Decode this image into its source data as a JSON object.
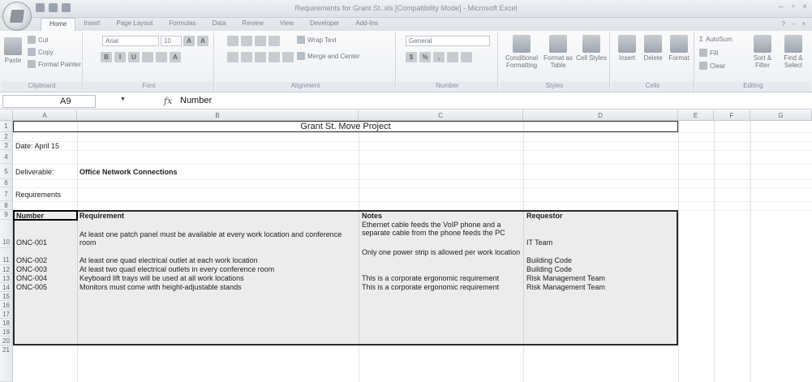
{
  "window": {
    "title": "Requirements for Grant St..xls [Compatibility Mode] - Microsoft Excel",
    "controls": [
      "–",
      "▫",
      "×"
    ]
  },
  "tabs": [
    "Home",
    "Insert",
    "Page Layout",
    "Formulas",
    "Data",
    "Review",
    "View",
    "Developer",
    "Add-Ins"
  ],
  "ribbon": {
    "clipboard": {
      "paste": "Paste",
      "cut": "Cut",
      "copy": "Copy",
      "format_painter": "Format Painter",
      "label": "Clipboard"
    },
    "font": {
      "name": "Arial",
      "size": "10",
      "label": "Font"
    },
    "alignment": {
      "wrap": "Wrap Text",
      "merge": "Merge and Center",
      "label": "Alignment"
    },
    "number": {
      "format": "General",
      "label": "Number"
    },
    "styles": {
      "conditional": "Conditional Formatting",
      "format_table": "Format as Table",
      "cell_styles": "Cell Styles",
      "label": "Styles"
    },
    "cells": {
      "insert": "Insert",
      "delete": "Delete",
      "format": "Format",
      "label": "Cells"
    },
    "editing": {
      "autosum": "AutoSum",
      "fill": "Fill",
      "clear": "Clear",
      "sort": "Sort & Filter",
      "find": "Find & Select",
      "label": "Editing"
    }
  },
  "formula_bar": {
    "name_box": "A9",
    "fx": "fx",
    "content": "Number"
  },
  "columns": [
    "A",
    "B",
    "C",
    "D",
    "E",
    "F",
    "G"
  ],
  "rows": [
    "1",
    "2",
    "3",
    "4",
    "5",
    "6",
    "7",
    "8",
    "9",
    "10",
    "11",
    "12",
    "13",
    "14",
    "15",
    "16",
    "17",
    "18",
    "19",
    "20",
    "21"
  ],
  "sheet": {
    "title": "Grant St. Move Project",
    "date": "Date: April 15",
    "deliverable_label": "Deliverable:",
    "deliverable_value": "Office Network Connections",
    "requirements_label": "Requirements",
    "headers": {
      "number": "Number",
      "requirement": "Requirement",
      "notes": "Notes",
      "requestor": "Requestor"
    },
    "rows": [
      {
        "number": "ONC-001",
        "requirement": "At least one patch panel must be available at every work location and conference room",
        "notes": "Ethernet cable feeds the VoIP phone and a separate cable from the phone feeds the PC",
        "requestor": "IT Team"
      },
      {
        "number": "ONC-002",
        "requirement": "At least one quad electrical outlet at each work location",
        "notes": "Only one power strip is allowed per work location",
        "requestor": "Building Code"
      },
      {
        "number": "ONC-003",
        "requirement": "At least two quad electrical outlets in every conference room",
        "notes": "",
        "requestor": "Building Code"
      },
      {
        "number": "ONC-004",
        "requirement": "Keyboard lift trays will be used at all work locations",
        "notes": "This is a corporate ergonomic requirement",
        "requestor": "Risk Management Team"
      },
      {
        "number": "ONC-005",
        "requirement": "Monitors must come with height-adjustable stands",
        "notes": "This is a corporate ergonomic requirement",
        "requestor": "Risk Management Team"
      }
    ]
  }
}
